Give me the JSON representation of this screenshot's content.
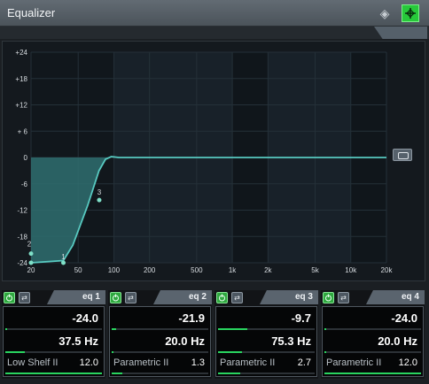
{
  "window": {
    "title": "Equalizer"
  },
  "graph": {
    "y_ticks": [
      "+24",
      "+18",
      "+12",
      "+ 6",
      "0",
      "-6",
      "-12",
      "-18",
      "-24"
    ],
    "x_ticks": [
      "20",
      "50",
      "100",
      "200",
      "500",
      "1k",
      "2k",
      "5k",
      "10k",
      "20k"
    ],
    "point_labels": [
      "2",
      "1",
      "3"
    ],
    "colors": {
      "curve": "#57c9c0",
      "fill": "#2f6e70",
      "point": "#7fe0c8",
      "grid": "#243038"
    }
  },
  "bands": [
    {
      "name": "eq 1",
      "gain": "-24.0",
      "freq": "37.5 Hz",
      "type": "Low Shelf II",
      "q": "12.0",
      "gain_level": 0.0,
      "freq_level": 0.2,
      "q_level": 1.0
    },
    {
      "name": "eq 2",
      "gain": "-21.9",
      "freq": "20.0 Hz",
      "type": "Parametric II",
      "q": "1.3",
      "gain_level": 0.05,
      "freq_level": 0.0,
      "q_level": 0.11
    },
    {
      "name": "eq 3",
      "gain": "-9.7",
      "freq": "75.3 Hz",
      "type": "Parametric II",
      "q": "2.7",
      "gain_level": 0.3,
      "freq_level": 0.25,
      "q_level": 0.23
    },
    {
      "name": "eq 4",
      "gain": "-24.0",
      "freq": "20.0 Hz",
      "type": "Parametric II",
      "q": "12.0",
      "gain_level": 0.0,
      "freq_level": 0.0,
      "q_level": 1.0
    }
  ]
}
